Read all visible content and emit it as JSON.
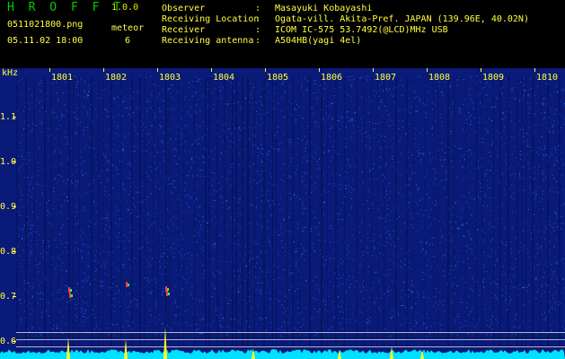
{
  "header": {
    "app_name": "H R O F F T",
    "version": "1.0.0",
    "filename": "0511021800.png",
    "datetime": "05.11.02 18:00",
    "meteor_label": "meteor",
    "meteor_count": "6",
    "info": [
      {
        "label": "Observer",
        "value": "Masayuki Kobayashi"
      },
      {
        "label": "Receiving Location",
        "value": "Ogata-vill. Akita-Pref. JAPAN (139.96E, 40.02N)"
      },
      {
        "label": "Receiver",
        "value": "ICOM IC-575 53.7492(@LCD)MHz USB"
      },
      {
        "label": "Receiving antenna",
        "value": "A504HB(yagi 4el)"
      }
    ],
    "separator": ":"
  },
  "spectrogram": {
    "unit": "kHz",
    "freq_ticks": [
      "1.1",
      "1.0",
      "0.9",
      "0.8",
      "0.7",
      "0.6"
    ],
    "time_ticks": [
      "1801",
      "1802",
      "1803",
      "1804",
      "1805",
      "1806",
      "1807",
      "1808",
      "1809",
      "1810"
    ],
    "colors": {
      "background": "#0a1a78",
      "noise": "#2f6bff",
      "bright": "#00e0e0",
      "meteor": "#ff4040",
      "peak": "#ffff20",
      "baseline": "#00e0ff"
    }
  }
}
